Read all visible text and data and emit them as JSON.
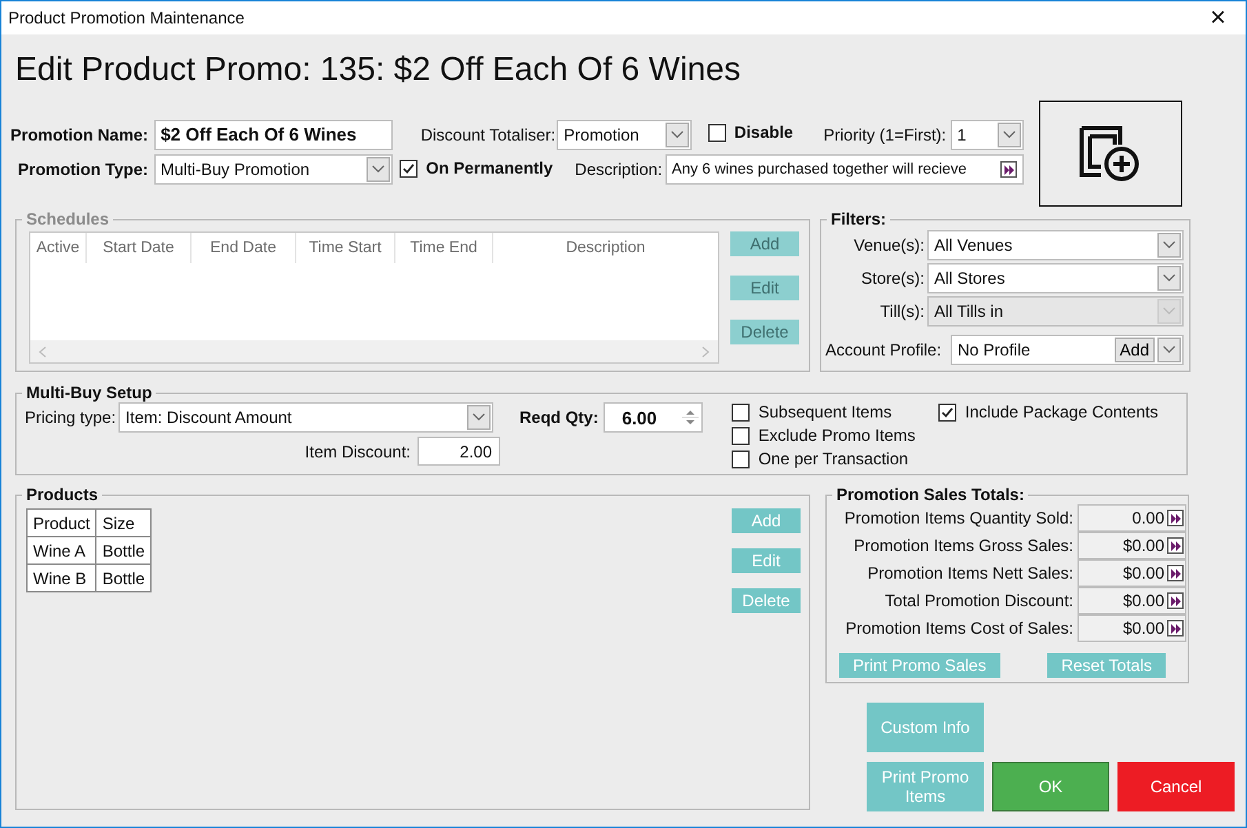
{
  "window": {
    "title": "Product Promotion Maintenance",
    "close": "×"
  },
  "heading": "Edit Product Promo: 135: $2 Off Each Of 6 Wines",
  "form": {
    "promotion_name": {
      "label": "Promotion Name:",
      "value": "$2 Off Each Of 6 Wines"
    },
    "promotion_type": {
      "label": "Promotion Type:",
      "value": "Multi-Buy Promotion"
    },
    "discount_totaliser": {
      "label": "Discount Totaliser:",
      "value": "Promotion"
    },
    "disable": {
      "label": "Disable",
      "checked": false
    },
    "on_permanently": {
      "label": "On Permanently",
      "checked": true
    },
    "priority": {
      "label": "Priority (1=First):",
      "value": "1"
    },
    "description": {
      "label": "Description:",
      "value": "Any 6 wines purchased together will recieve"
    }
  },
  "schedules": {
    "title": "Schedules",
    "disabled": true,
    "columns": [
      "Active",
      "Start Date",
      "End Date",
      "Time Start",
      "Time End",
      "Description"
    ],
    "buttons": [
      "Add",
      "Edit",
      "Delete"
    ]
  },
  "filters": {
    "title": "Filters:",
    "fields": [
      {
        "label": "Venue(s):",
        "value": "All Venues",
        "disabled": false
      },
      {
        "label": "Store(s):",
        "value": "All Stores",
        "disabled": false
      },
      {
        "label": "Till(s):",
        "value": "All Tills in",
        "disabled": true
      }
    ],
    "account_profile": {
      "label": "Account Profile:",
      "value": "No Profile",
      "button": "Add"
    }
  },
  "multi_buy": {
    "title": "Multi-Buy Setup",
    "pricing_type": {
      "label": "Pricing type:",
      "value": "Item: Discount Amount"
    },
    "item_discount": {
      "label": "Item Discount:",
      "value": "2.00"
    },
    "reqd_qty": {
      "label": "Reqd Qty:",
      "value": "6.00"
    },
    "options": [
      {
        "label": "Subsequent Items",
        "checked": false
      },
      {
        "label": "Exclude Promo Items",
        "checked": false
      },
      {
        "label": "One per Transaction",
        "checked": false
      },
      {
        "label": "Include Package Contents",
        "checked": true
      }
    ]
  },
  "products": {
    "title": "Products",
    "columns": [
      "Product",
      "Size"
    ],
    "rows": [
      [
        "Wine A",
        "Bottle"
      ],
      [
        "Wine B",
        "Bottle"
      ]
    ],
    "buttons": [
      "Add",
      "Edit",
      "Delete"
    ]
  },
  "sales_totals": {
    "title": "Promotion Sales Totals:",
    "rows": [
      {
        "label": "Promotion Items Quantity Sold:",
        "value": "0.00"
      },
      {
        "label": "Promotion Items Gross Sales:",
        "value": "$0.00"
      },
      {
        "label": "Promotion Items Nett Sales:",
        "value": "$0.00"
      },
      {
        "label": "Total Promotion Discount:",
        "value": "$0.00"
      },
      {
        "label": "Promotion Items Cost of Sales:",
        "value": "$0.00"
      }
    ],
    "buttons": [
      "Print Promo Sales",
      "Reset Totals"
    ]
  },
  "actions": [
    {
      "label": "Custom Info",
      "kind": "secondary"
    },
    {
      "label": "Print Promo Items",
      "kind": "secondary"
    },
    {
      "label": "OK",
      "kind": "ok"
    },
    {
      "label": "Cancel",
      "kind": "cancel"
    }
  ]
}
